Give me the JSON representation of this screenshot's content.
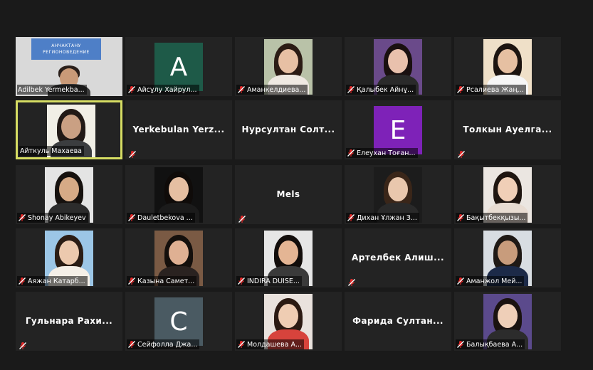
{
  "colors": {
    "background": "#1a1a1a",
    "tile": "#232323",
    "active_border": "#d6dd63",
    "mute": "#e02828",
    "avatar_A": "#1e5a48",
    "avatar_E": "#7e22b8",
    "avatar_C": "#4a5a62"
  },
  "presenter_banner": {
    "line1": "АНЧАКТАНУ",
    "line2": "РЕГИОНОВЕДЕНИЕ"
  },
  "participants": [
    {
      "name": "Adilbek Yermekba...",
      "type": "video",
      "muted": false
    },
    {
      "name": "Айсұлу Хайрул...",
      "type": "avatar",
      "initial": "A",
      "muted": true
    },
    {
      "name": "Аманкелдиева...",
      "type": "video",
      "muted": true
    },
    {
      "name": "Қалыбек Айнұ...",
      "type": "video",
      "muted": true
    },
    {
      "name": "Рсалиева Жаң...",
      "type": "video",
      "muted": true
    },
    {
      "name": "Айткуль Махаева",
      "type": "video",
      "muted": false,
      "active": true
    },
    {
      "name": "Yerkebulan Yerz...",
      "type": "name",
      "muted": true
    },
    {
      "name": "Нурсултан Солт...",
      "type": "name",
      "muted": false
    },
    {
      "name": "Елеухан Тоған...",
      "type": "avatar",
      "initial": "E",
      "muted": true
    },
    {
      "name": "Толкын Ауелга...",
      "type": "name",
      "muted": true
    },
    {
      "name": "Shonay Abikeyev",
      "type": "video",
      "muted": true
    },
    {
      "name": "Dauletbekova ...",
      "type": "video",
      "muted": true
    },
    {
      "name": "Mels",
      "type": "name",
      "muted": true
    },
    {
      "name": "Дихан Ұлжан З...",
      "type": "video",
      "muted": true
    },
    {
      "name": "Бақытбекқызы...",
      "type": "video",
      "muted": true
    },
    {
      "name": "Аяжан Катарб...",
      "type": "video",
      "muted": true
    },
    {
      "name": "Казына Самет...",
      "type": "video",
      "muted": true
    },
    {
      "name": "INDIRA DUISE...",
      "type": "video",
      "muted": true
    },
    {
      "name": "Артелбек Алиш...",
      "type": "name",
      "muted": true
    },
    {
      "name": "Аманжол Мей...",
      "type": "video",
      "muted": true
    },
    {
      "name": "Гульнара Рахи...",
      "type": "name",
      "muted": true
    },
    {
      "name": "Сейфолла Джа...",
      "type": "avatar",
      "initial": "C",
      "muted": true
    },
    {
      "name": "Молдашева А...",
      "type": "video",
      "muted": true
    },
    {
      "name": "Фарида Султан...",
      "type": "name",
      "muted": false
    },
    {
      "name": "Балықбаева А...",
      "type": "video",
      "muted": true
    }
  ]
}
